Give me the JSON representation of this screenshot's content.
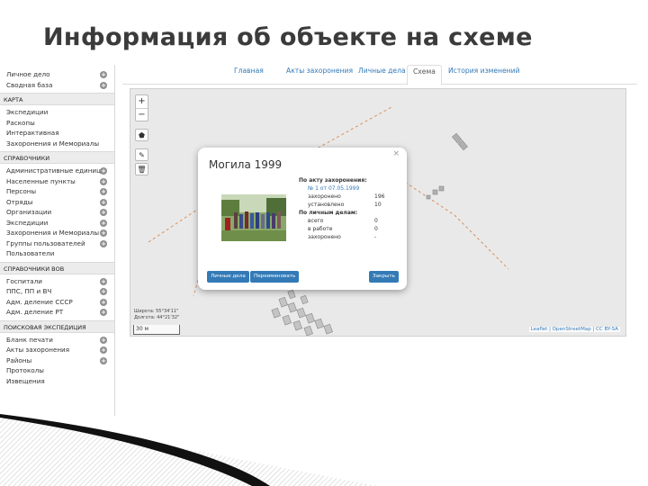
{
  "slide": {
    "title": "Информация об объекте на схеме"
  },
  "sidebar": {
    "top_items": [
      {
        "label": "Личное дело",
        "plus": true
      },
      {
        "label": "Сводная база",
        "plus": true
      }
    ],
    "sections": [
      {
        "title": "КАРТА",
        "items": [
          {
            "label": "Экспедиции",
            "plus": false
          },
          {
            "label": "Раскопы",
            "plus": false
          },
          {
            "label": "Интерактивная",
            "plus": false
          },
          {
            "label": "Захоронения и Мемориалы",
            "plus": false
          }
        ]
      },
      {
        "title": "СПРАВОЧНИКИ",
        "items": [
          {
            "label": "Административные единицы",
            "plus": true
          },
          {
            "label": "Населенные пункты",
            "plus": true
          },
          {
            "label": "Персоны",
            "plus": true
          },
          {
            "label": "Отряды",
            "plus": true
          },
          {
            "label": "Организации",
            "plus": true
          },
          {
            "label": "Экспедиции",
            "plus": true
          },
          {
            "label": "Захоронения и Мемориалы",
            "plus": true
          },
          {
            "label": "Группы пользователей",
            "plus": true
          },
          {
            "label": "Пользователи",
            "plus": false
          }
        ]
      },
      {
        "title": "СПРАВОЧНИКИ ВОВ",
        "items": [
          {
            "label": "Госпитали",
            "plus": true
          },
          {
            "label": "ППС, ПП и ВЧ",
            "plus": true
          },
          {
            "label": "Адм. деление СССР",
            "plus": true
          },
          {
            "label": "Адм. деление РТ",
            "plus": true
          }
        ]
      },
      {
        "title": "ПОИСКОВАЯ ЭКСПЕДИЦИЯ",
        "items": [
          {
            "label": "Бланк печати",
            "plus": true
          },
          {
            "label": "Акты захоронения",
            "plus": true
          },
          {
            "label": "Районы",
            "plus": true
          },
          {
            "label": "Протоколы",
            "plus": false
          },
          {
            "label": "Извещения",
            "plus": false
          }
        ]
      }
    ]
  },
  "tabs": [
    {
      "label": "Главная",
      "active": false
    },
    {
      "label": "Акты захоронения",
      "active": false
    },
    {
      "label": "Личные дела",
      "active": false
    },
    {
      "label": "Схема",
      "active": true
    },
    {
      "label": "История изменений",
      "active": false
    }
  ],
  "map": {
    "zoom_in": "+",
    "zoom_out": "−",
    "coords_line1": "Широта: 55°34'11\"",
    "coords_line2": "Долгота: 44°21'32\"",
    "scale": "30 м",
    "attribution": "Leaflet | OpenStreetMap | CC BY-SA"
  },
  "popup": {
    "close": "×",
    "title": "Могила 1999",
    "act_header": "По акту захоронения:",
    "act_link": "№ 1 от 07.05.1999",
    "act_rows": [
      {
        "label": "захоронено",
        "value": "196"
      },
      {
        "label": "установлено",
        "value": "10"
      }
    ],
    "files_header": "По личным делам:",
    "files_rows": [
      {
        "label": "всего",
        "value": "0"
      },
      {
        "label": "в работе",
        "value": "0"
      },
      {
        "label": "захоронено",
        "value": "-"
      }
    ],
    "btn_files": "Личные дела",
    "btn_rename": "Переименовать",
    "btn_close": "Закрыть"
  },
  "colors": {
    "link": "#337ab7",
    "button": "#337ab7",
    "map_bg": "#e9e9e9"
  }
}
